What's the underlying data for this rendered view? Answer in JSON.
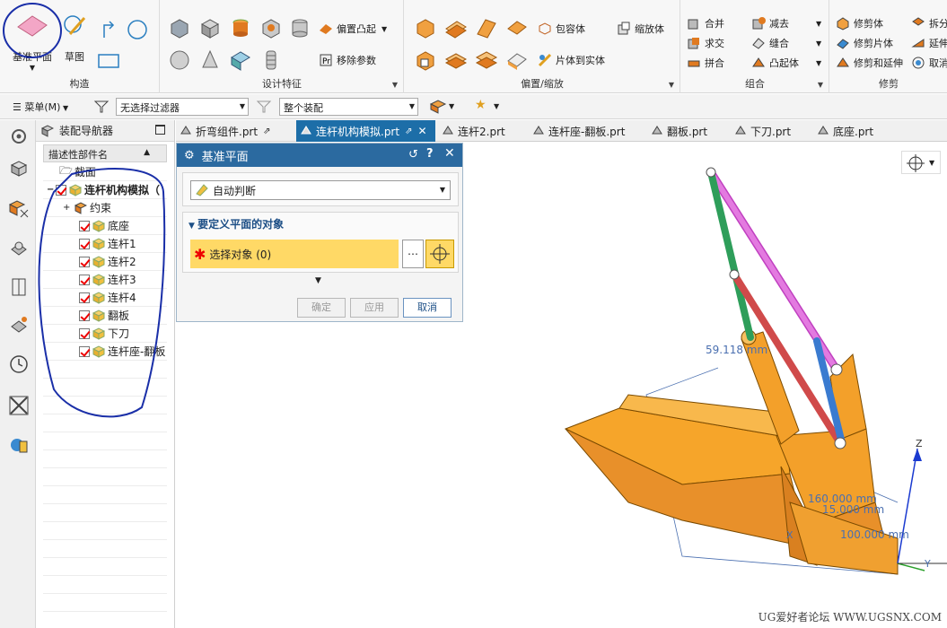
{
  "ribbon": {
    "construct": {
      "datum_plane": "基准平面",
      "sketch": "草图",
      "label": "构造"
    },
    "design_feature": {
      "offset_boss": "偏置凸起",
      "remove_params": "移除参数",
      "label": "设计特征"
    },
    "offset_scale": {
      "wrap_body": "包容体",
      "scale_body": "缩放体",
      "sheet_to_solid": "片体到实体",
      "label": "偏置/缩放"
    },
    "combine": {
      "unite": "合并",
      "subtract": "减去",
      "intersect": "求交",
      "sew": "缝合",
      "patch": "拼合",
      "emboss": "凸起体",
      "label": "组合"
    },
    "trim": {
      "trim_body": "修剪体",
      "split": "拆分",
      "trim_sheet": "修剪片体",
      "extend": "延伸",
      "trim_extend": "修剪和延伸",
      "cancel": "取消",
      "label": "修剪"
    }
  },
  "toolbar": {
    "menu": "菜单(M)",
    "filter": "无选择过滤器",
    "scope": "整个装配"
  },
  "navigator": {
    "title": "装配导航器",
    "column": "描述性部件名",
    "items": [
      {
        "label": "截面"
      },
      {
        "label": "连杆机构模拟（"
      },
      {
        "label": "约束"
      },
      {
        "label": "底座"
      },
      {
        "label": "连杆1"
      },
      {
        "label": "连杆2"
      },
      {
        "label": "连杆3"
      },
      {
        "label": "连杆4"
      },
      {
        "label": "翻板"
      },
      {
        "label": "下刀"
      },
      {
        "label": "连杆座-翻板"
      }
    ]
  },
  "tabs": [
    {
      "label": "折弯组件.prt"
    },
    {
      "label": "连杆机构模拟.prt"
    },
    {
      "label": "连杆2.prt"
    },
    {
      "label": "连杆座-翻板.prt"
    },
    {
      "label": "翻板.prt"
    },
    {
      "label": "下刀.prt"
    },
    {
      "label": "底座.prt"
    }
  ],
  "dialog": {
    "title": "基准平面",
    "type_value": "自动判断",
    "section": "要定义平面的对象",
    "select": "选择对象 (0)",
    "ok": "确定",
    "apply": "应用",
    "cancel": "取消"
  },
  "viewport": {
    "dim1": "59.118 mm",
    "dim2": "160.000 mm",
    "dim3": "15.000 mm",
    "dim4": "100.000 mm",
    "axis_z": "Z",
    "axis_x": "X",
    "axis_y": "Y"
  },
  "watermark": "UG爱好者论坛 WWW.UGSNX.COM",
  "colors": {
    "accent": "#1d6ea8",
    "body": "#f39a1b",
    "highlight": "#ffd966"
  }
}
